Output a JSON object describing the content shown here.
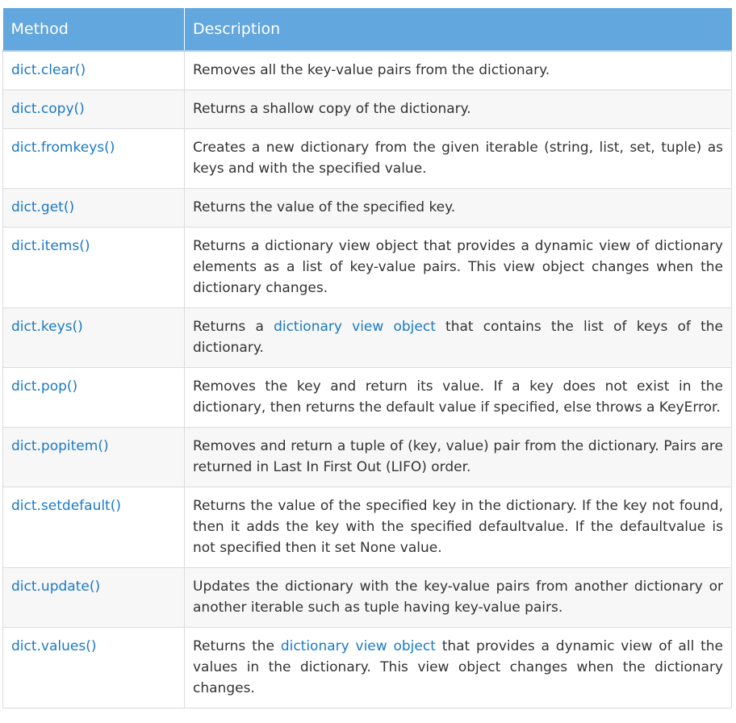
{
  "table": {
    "headers": [
      "Method",
      "Description"
    ],
    "rows": [
      {
        "method": "dict.clear()",
        "desc": [
          {
            "text": "Removes all the key-value pairs from the dictionary."
          }
        ]
      },
      {
        "method": "dict.copy()",
        "desc": [
          {
            "text": "Returns a shallow copy of the dictionary."
          }
        ]
      },
      {
        "method": "dict.fromkeys()",
        "desc": [
          {
            "text": "Creates a new dictionary from the given iterable (string, list, set, tuple) as keys and with the specified value."
          }
        ]
      },
      {
        "method": "dict.get()",
        "desc": [
          {
            "text": "Returns the value of the specified key."
          }
        ]
      },
      {
        "method": "dict.items()",
        "desc": [
          {
            "text": "Returns a dictionary view object that provides a dynamic view of dictionary elements as a list of key-value pairs. This view object changes when the dictionary changes."
          }
        ]
      },
      {
        "method": "dict.keys()",
        "desc": [
          {
            "text": "Returns a "
          },
          {
            "text": "dictionary view object",
            "link": true
          },
          {
            "text": " that contains the list of keys of the dictionary."
          }
        ]
      },
      {
        "method": "dict.pop()",
        "desc": [
          {
            "text": "Removes the key and return its value. If a key does not exist in the dictionary, then returns the default value if specified, else throws a KeyError."
          }
        ]
      },
      {
        "method": "dict.popitem()",
        "desc": [
          {
            "text": "Removes and return a tuple of (key, value) pair from the dictionary. Pairs are returned in Last In First Out (LIFO) order."
          }
        ]
      },
      {
        "method": "dict.setdefault()",
        "desc": [
          {
            "text": "Returns the value of the specified key in the dictionary. If the key not found, then it adds the key with the specified defaultvalue. If the defaultvalue is not specified then it set None value."
          }
        ]
      },
      {
        "method": "dict.update()",
        "desc": [
          {
            "text": "Updates the dictionary with the key-value pairs from another dictionary or another iterable such as tuple having key-value pairs."
          }
        ]
      },
      {
        "method": "dict.values()",
        "desc": [
          {
            "text": "Returns the "
          },
          {
            "text": "dictionary view object",
            "link": true
          },
          {
            "text": " that provides a dynamic view of all the values in the dictionary. This view object changes when the dictionary changes."
          }
        ]
      }
    ]
  },
  "colors": {
    "header_bg": "#62a7dd",
    "link": "#1a79c6",
    "text": "#333333",
    "stripe": "#f7f7f7"
  }
}
